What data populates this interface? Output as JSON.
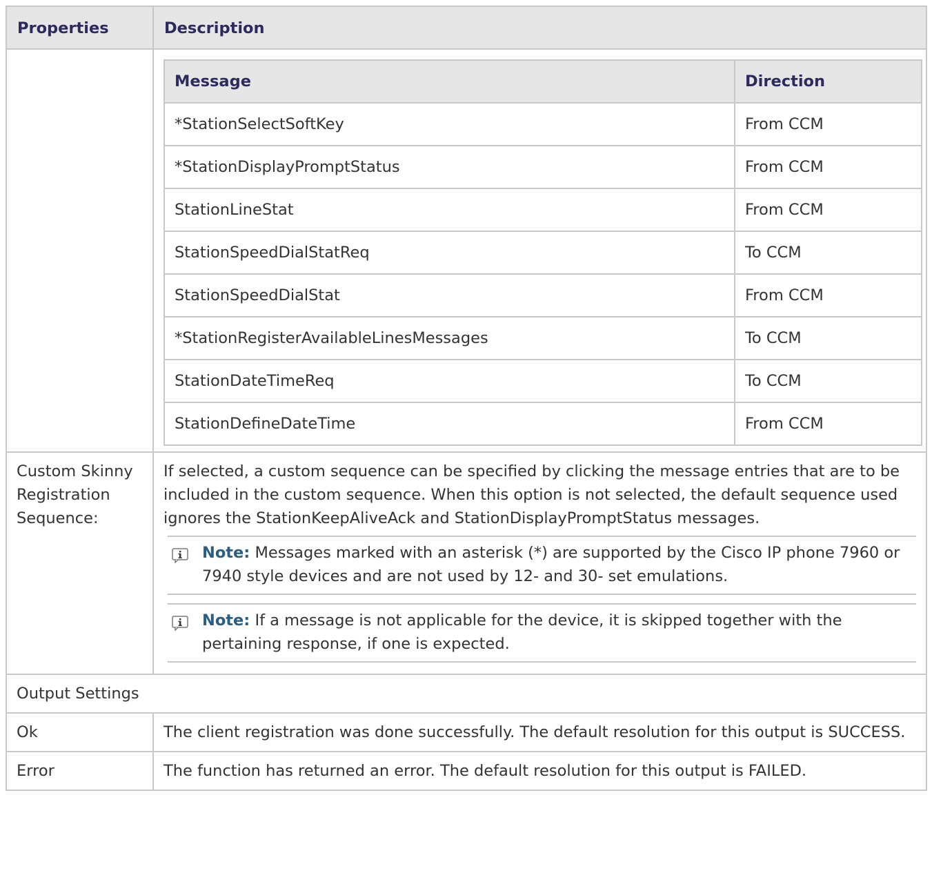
{
  "table": {
    "header": {
      "properties": "Properties",
      "description": "Description"
    },
    "messages_table": {
      "header": {
        "message": "Message",
        "direction": "Direction"
      },
      "rows": [
        {
          "message": "*StationSelectSoftKey",
          "direction": "From CCM"
        },
        {
          "message": "*StationDisplayPromptStatus",
          "direction": "From CCM"
        },
        {
          "message": "StationLineStat",
          "direction": "From CCM"
        },
        {
          "message": "StationSpeedDialStatReq",
          "direction": "To CCM"
        },
        {
          "message": "StationSpeedDialStat",
          "direction": "From CCM"
        },
        {
          "message": "*StationRegisterAvailableLinesMessages",
          "direction": "To CCM"
        },
        {
          "message": "StationDateTimeReq",
          "direction": "To CCM"
        },
        {
          "message": "StationDefineDateTime",
          "direction": "From CCM"
        }
      ]
    },
    "custom_sequence": {
      "property": "Custom Skinny Registration Sequence:",
      "description": "If selected, a custom sequence can be specified by clicking the message entries that are to be included in the custom sequence. When this option is not selected, the default sequence used ignores the StationKeepAliveAck and StationDisplayPromptStatus messages.",
      "notes": [
        {
          "label": "Note:",
          "icon": "info-icon",
          "text": "Messages marked with an asterisk (*) are supported by the Cisco IP phone 7960 or 7940 style devices and are not used by 12- and 30- set emulations."
        },
        {
          "label": "Note:",
          "icon": "info-icon",
          "text": "If a message is not applicable for the device, it is skipped together with the pertaining response, if one is expected."
        }
      ]
    },
    "output_settings": {
      "label": "Output Settings",
      "rows": [
        {
          "property": "Ok",
          "description": "The client registration was done successfully. The default resolution for this output is SUCCESS."
        },
        {
          "property": "Error",
          "description": "The function has returned an error. The default resolution for this output is FAILED."
        }
      ]
    }
  },
  "colors": {
    "header_bg": "#e6e6e6",
    "header_text": "#2d2a5e",
    "note_label": "#2b5e82",
    "border": "#c8c8c8"
  }
}
